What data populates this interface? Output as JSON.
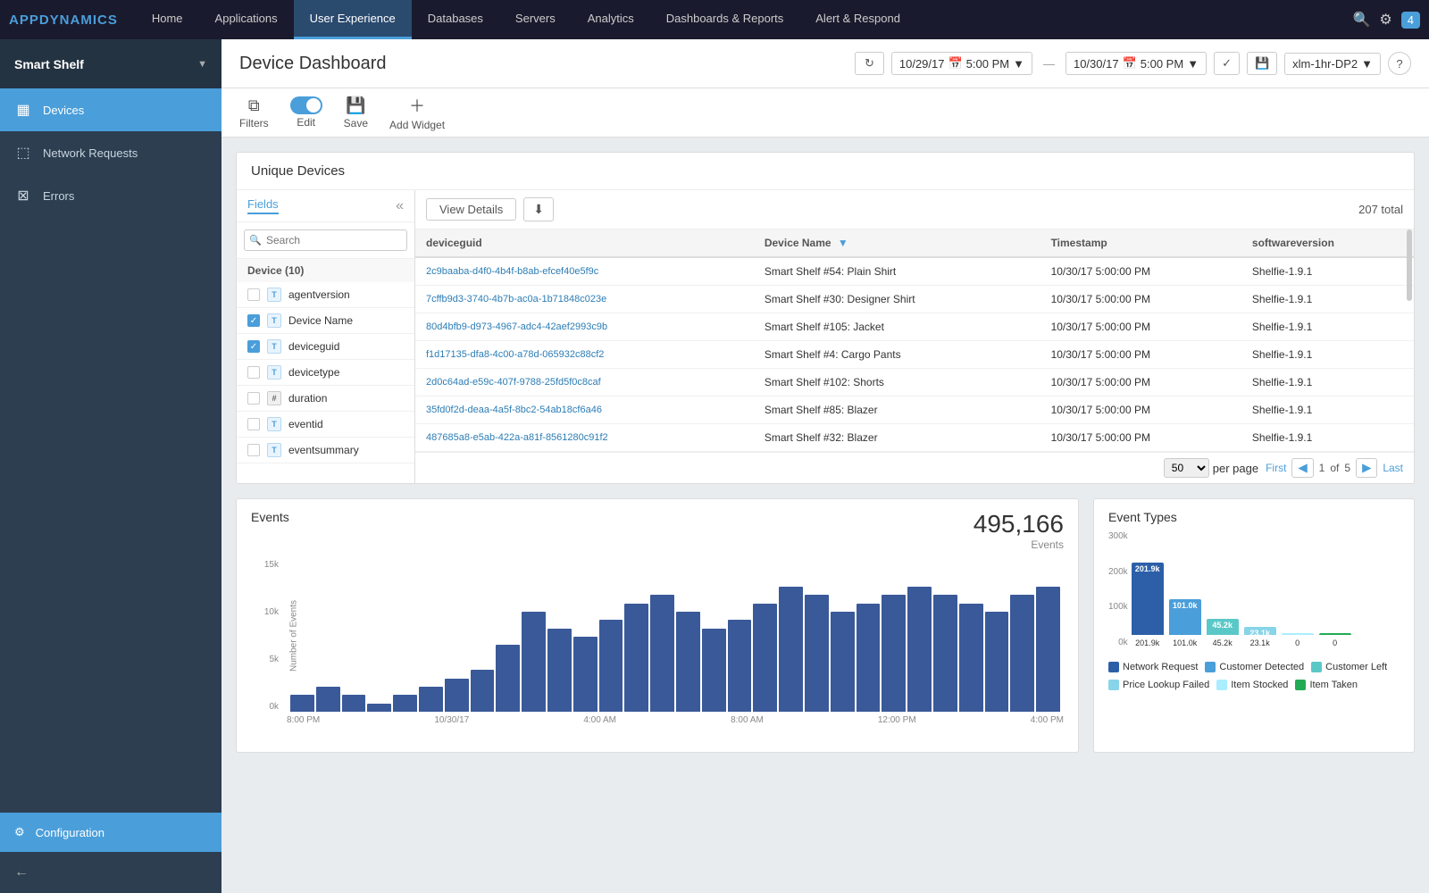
{
  "app": {
    "logo_prefix": "APP",
    "logo_suffix": "DYNAMICS"
  },
  "top_nav": {
    "items": [
      {
        "label": "Home",
        "active": false
      },
      {
        "label": "Applications",
        "active": false
      },
      {
        "label": "User Experience",
        "active": true
      },
      {
        "label": "Databases",
        "active": false
      },
      {
        "label": "Servers",
        "active": false
      },
      {
        "label": "Analytics",
        "active": false
      },
      {
        "label": "Dashboards & Reports",
        "active": false
      },
      {
        "label": "Alert & Respond",
        "active": false
      }
    ],
    "notification_count": "4"
  },
  "sidebar": {
    "app_name": "Smart Shelf",
    "items": [
      {
        "label": "Devices",
        "icon": "▦",
        "active": true
      },
      {
        "label": "Network Requests",
        "icon": "⬚",
        "active": false
      },
      {
        "label": "Errors",
        "icon": "⊠",
        "active": false
      }
    ],
    "config_label": "Configuration"
  },
  "page_header": {
    "title": "Device Dashboard",
    "refresh_btn": "↻",
    "start_date": "10/29/17",
    "start_time": "5:00 PM",
    "end_date": "10/30/17",
    "end_time": "5:00 PM",
    "preset": "xlm-1hr-DP2",
    "help": "?"
  },
  "toolbar": {
    "filters_label": "Filters",
    "edit_label": "Edit",
    "save_label": "Save",
    "add_widget_label": "Add Widget"
  },
  "unique_devices": {
    "title": "Unique Devices",
    "fields_tab": "Fields",
    "search_placeholder": "Search",
    "group_label": "Device (10)",
    "fields": [
      {
        "name": "agentversion",
        "type": "T",
        "checked": false
      },
      {
        "name": "Device Name",
        "type": "T",
        "checked": true
      },
      {
        "name": "deviceguid",
        "type": "T",
        "checked": true
      },
      {
        "name": "devicetype",
        "type": "T",
        "checked": false
      },
      {
        "name": "duration",
        "type": "#",
        "checked": false
      },
      {
        "name": "eventid",
        "type": "T",
        "checked": false
      },
      {
        "name": "eventsummary",
        "type": "T",
        "checked": false
      }
    ],
    "view_details_btn": "View Details",
    "total_count": "207 total",
    "columns": [
      "deviceguid",
      "Device Name",
      "Timestamp",
      "softwareversion"
    ],
    "rows": [
      {
        "deviceguid": "2c9baaba-d4f0-4b4f-b8ab-efcef40e5f9c",
        "device_name": "Smart Shelf #54: Plain Shirt",
        "timestamp": "10/30/17 5:00:00 PM",
        "softwareversion": "Shelfie-1.9.1"
      },
      {
        "deviceguid": "7cffb9d3-3740-4b7b-ac0a-1b71848c023e",
        "device_name": "Smart Shelf #30: Designer Shirt",
        "timestamp": "10/30/17 5:00:00 PM",
        "softwareversion": "Shelfie-1.9.1"
      },
      {
        "deviceguid": "80d4bfb9-d973-4967-adc4-42aef2993c9b",
        "device_name": "Smart Shelf #105: Jacket",
        "timestamp": "10/30/17 5:00:00 PM",
        "softwareversion": "Shelfie-1.9.1"
      },
      {
        "deviceguid": "f1d17135-dfa8-4c00-a78d-065932c88cf2",
        "device_name": "Smart Shelf #4: Cargo Pants",
        "timestamp": "10/30/17 5:00:00 PM",
        "softwareversion": "Shelfie-1.9.1"
      },
      {
        "deviceguid": "2d0c64ad-e59c-407f-9788-25fd5f0c8caf",
        "device_name": "Smart Shelf #102: Shorts",
        "timestamp": "10/30/17 5:00:00 PM",
        "softwareversion": "Shelfie-1.9.1"
      },
      {
        "deviceguid": "35fd0f2d-deaa-4a5f-8bc2-54ab18cf6a46",
        "device_name": "Smart Shelf #85: Blazer",
        "timestamp": "10/30/17 5:00:00 PM",
        "softwareversion": "Shelfie-1.9.1"
      },
      {
        "deviceguid": "487685a8-e5ab-422a-a81f-8561280c91f2",
        "device_name": "Smart Shelf #32: Blazer",
        "timestamp": "10/30/17 5:00:00 PM",
        "softwareversion": "Shelfie-1.9.1"
      }
    ],
    "per_page": "50",
    "page_current": "1",
    "page_total": "5",
    "first_label": "First",
    "last_label": "Last",
    "per_page_label": "per page"
  },
  "events": {
    "title": "Events",
    "total_number": "495,166",
    "total_label": "Events",
    "y_labels": [
      "15k",
      "10k",
      "5k",
      "0k"
    ],
    "x_labels": [
      "8:00 PM",
      "10/30/17",
      "4:00 AM",
      "8:00 AM",
      "12:00 PM",
      "4:00 PM"
    ],
    "axis_title": "Number of Events",
    "bars": [
      2,
      3,
      2,
      1,
      2,
      3,
      4,
      5,
      8,
      12,
      10,
      9,
      11,
      13,
      14,
      12,
      10,
      11,
      13,
      15,
      14,
      12,
      13,
      14,
      15,
      14,
      13,
      12,
      14,
      15
    ]
  },
  "event_types": {
    "title": "Event Types",
    "y_labels": [
      "300k",
      "200k",
      "100k",
      "0k"
    ],
    "bars": [
      {
        "label": "201.9k",
        "value": 201.9,
        "color": "#2c5fa8",
        "name": "Network Request"
      },
      {
        "label": "101.0k",
        "value": 101.0,
        "color": "#4a9eda",
        "name": "Customer Detected"
      },
      {
        "label": "45.2k",
        "value": 45.2,
        "color": "#5bc8c8",
        "name": "Customer Left"
      },
      {
        "label": "23.1k",
        "value": 23.1,
        "color": "#88d4e8",
        "name": "Price Lookup Failed"
      },
      {
        "label": "0",
        "value": 1.5,
        "color": "#aaeeff",
        "name": "Item Stocked"
      },
      {
        "label": "0",
        "value": 2.0,
        "color": "#22aa55",
        "name": "Item Taken"
      }
    ],
    "legend": [
      {
        "label": "Network Request",
        "color": "#2c5fa8"
      },
      {
        "label": "Customer Detected",
        "color": "#4a9eda"
      },
      {
        "label": "Customer Left",
        "color": "#5bc8c8"
      },
      {
        "label": "Price Lookup Failed",
        "color": "#88d4e8"
      },
      {
        "label": "Item Stocked",
        "color": "#aaeeff"
      },
      {
        "label": "Item Taken",
        "color": "#22aa55"
      }
    ]
  }
}
